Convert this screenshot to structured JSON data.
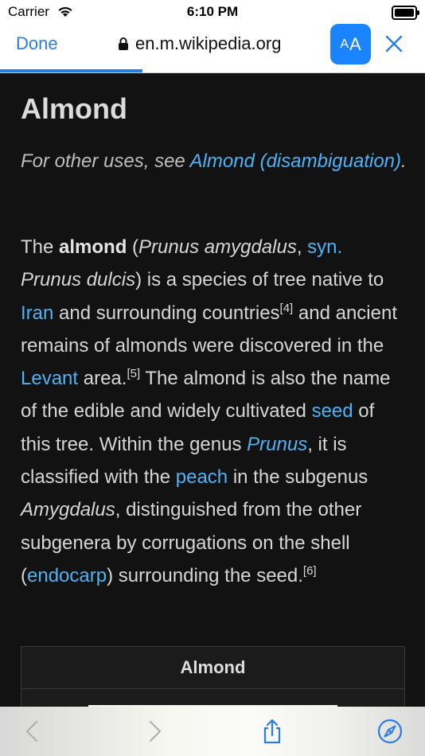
{
  "status_bar": {
    "carrier": "Carrier",
    "time": "6:10 PM"
  },
  "navbar": {
    "done_label": "Done",
    "url": "en.m.wikipedia.org",
    "reader_label_small": "A",
    "reader_label_large": "A",
    "load_progress": 0.335
  },
  "article": {
    "title": "Almond",
    "hatnote": {
      "prefix": "For other uses, see ",
      "link": "Almond (disambiguation)",
      "suffix": "."
    },
    "paragraph": {
      "t1": "The ",
      "b1": "almond",
      "t2": " (",
      "i1": "Prunus amygdalus",
      "t3": ", ",
      "l1": "syn.",
      "t4": " ",
      "i2": "Prunus dulcis",
      "t5": ") is a species of tree native to ",
      "l2": "Iran",
      "t6": " and surrounding countries",
      "s1": "[4]",
      "t7": " and ancient remains of almonds were discovered in the ",
      "l3": "Levant",
      "t8": " area.",
      "s2": "[5]",
      "t9": " The almond is also the name of the edible and widely cultivated ",
      "l4": "seed",
      "t10": " of this tree. Within the genus ",
      "l5": "Prunus",
      "t11": ", it is classified with the ",
      "l6": "peach",
      "t12": " in the subgenus ",
      "i3": "Amygdalus",
      "t13": ", distinguished from the other subgenera by corrugations on the shell (",
      "l7": "endocarp",
      "t14": ") surrounding the seed.",
      "s3": "[6]"
    },
    "infobox_title": "Almond"
  },
  "toolbar": {
    "icons": [
      "back-icon",
      "forward-icon",
      "share-icon",
      "compass-icon"
    ]
  },
  "colors": {
    "link": "#4fb2f5",
    "accent": "#1a84ff",
    "background": "#121212"
  }
}
